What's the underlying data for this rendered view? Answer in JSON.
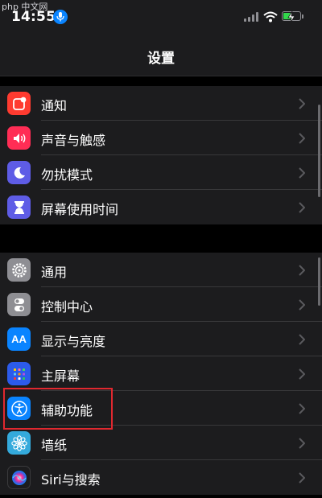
{
  "statusbar": {
    "watermark": "php 中文网",
    "time": "14:55",
    "icons": [
      "microphone-icon",
      "cellular-signal-icon",
      "wifi-icon",
      "battery-charging-icon"
    ],
    "battery_level": 0.45
  },
  "navbar": {
    "title": "设置"
  },
  "groups": [
    {
      "items": [
        {
          "label": "通知",
          "icon": "notifications-icon",
          "color": "#ff3b30"
        },
        {
          "label": "声音与触感",
          "icon": "sound-icon",
          "color": "#ff2d55"
        },
        {
          "label": "勿扰模式",
          "icon": "moon-icon",
          "color": "#5e5ce6"
        },
        {
          "label": "屏幕使用时间",
          "icon": "hourglass-icon",
          "color": "#5e5ce6"
        }
      ]
    },
    {
      "items": [
        {
          "label": "通用",
          "icon": "gear-icon",
          "color": "#8e8e93"
        },
        {
          "label": "控制中心",
          "icon": "toggles-icon",
          "color": "#8e8e93"
        },
        {
          "label": "显示与亮度",
          "icon": "display-aa-icon",
          "icon_text": "AA",
          "color": "#0a84ff"
        },
        {
          "label": "主屏幕",
          "icon": "home-screen-icon",
          "color": "#2c5bea"
        },
        {
          "label": "辅助功能",
          "icon": "accessibility-icon",
          "color": "#0a84ff",
          "highlighted": true
        },
        {
          "label": "墙纸",
          "icon": "wallpaper-flower-icon",
          "color": "#34aadc"
        },
        {
          "label": "Siri与搜索",
          "icon": "siri-icon",
          "color": "#1c1c1e"
        }
      ]
    }
  ],
  "annotation": {
    "highlight_color": "#e0282f"
  }
}
